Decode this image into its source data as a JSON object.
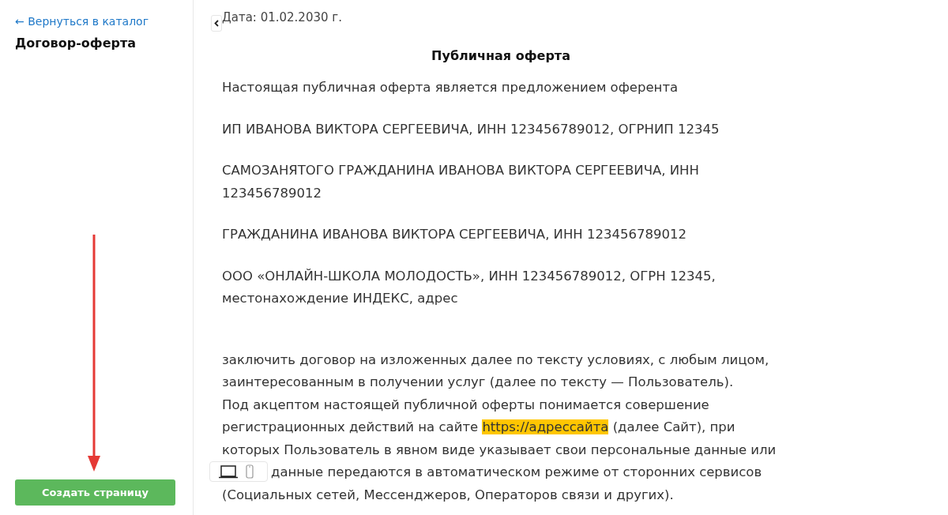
{
  "sidebar": {
    "back_link": "← Вернуться в каталог",
    "title": "Договор-оферта",
    "button": "Создать страницу"
  },
  "document": {
    "date": "Дата: 01.02.2030 г.",
    "title": "Публичная оферта",
    "paragraphs": [
      {
        "lines": [
          "Настоящая публичная оферта является предложением оферента"
        ]
      },
      {
        "lines": [
          "ИП ИВАНОВА ВИКТОРА СЕРГЕЕВИЧА, ИНН 123456789012, ОГРНИП 12345"
        ]
      },
      {
        "lines": [
          "САМОЗАНЯТОГО ГРАЖДАНИНА ИВАНОВА ВИКТОРА СЕРГЕЕВИЧА, ИНН",
          "123456789012"
        ]
      },
      {
        "lines": [
          "ГРАЖДАНИНА ИВАНОВА ВИКТОРА СЕРГЕЕВИЧА, ИНН 123456789012"
        ]
      },
      {
        "lines": [
          "ООО «ОНЛАЙН-ШКОЛА МОЛОДОСТЬ», ИНН 123456789012, ОГРН 12345,",
          "местонахождение ИНДЕКС, адрес"
        ]
      },
      {
        "lines": [
          "заключить договор на изложенных далее по тексту условиях, с любым лицом,",
          "заинтересованным в получении услуг (далее по тексту — Пользователь).",
          "Под акцептом настоящей публичной оферты понимается совершение",
          [
            {
              "text": "регистрационных действий на сайте ",
              "highlighted": false
            },
            {
              "text": "https://адрессайта",
              "highlighted": true
            },
            {
              "text": " (далее Сайт), при",
              "highlighted": false
            }
          ],
          "которых Пользователь в явном виде указывает свои персональные данные или",
          "данные передаются в автоматическом режиме от сторонних сервисов",
          "(Социальных сетей, Мессенджеров, Операторов связи и других)."
        ]
      }
    ]
  }
}
